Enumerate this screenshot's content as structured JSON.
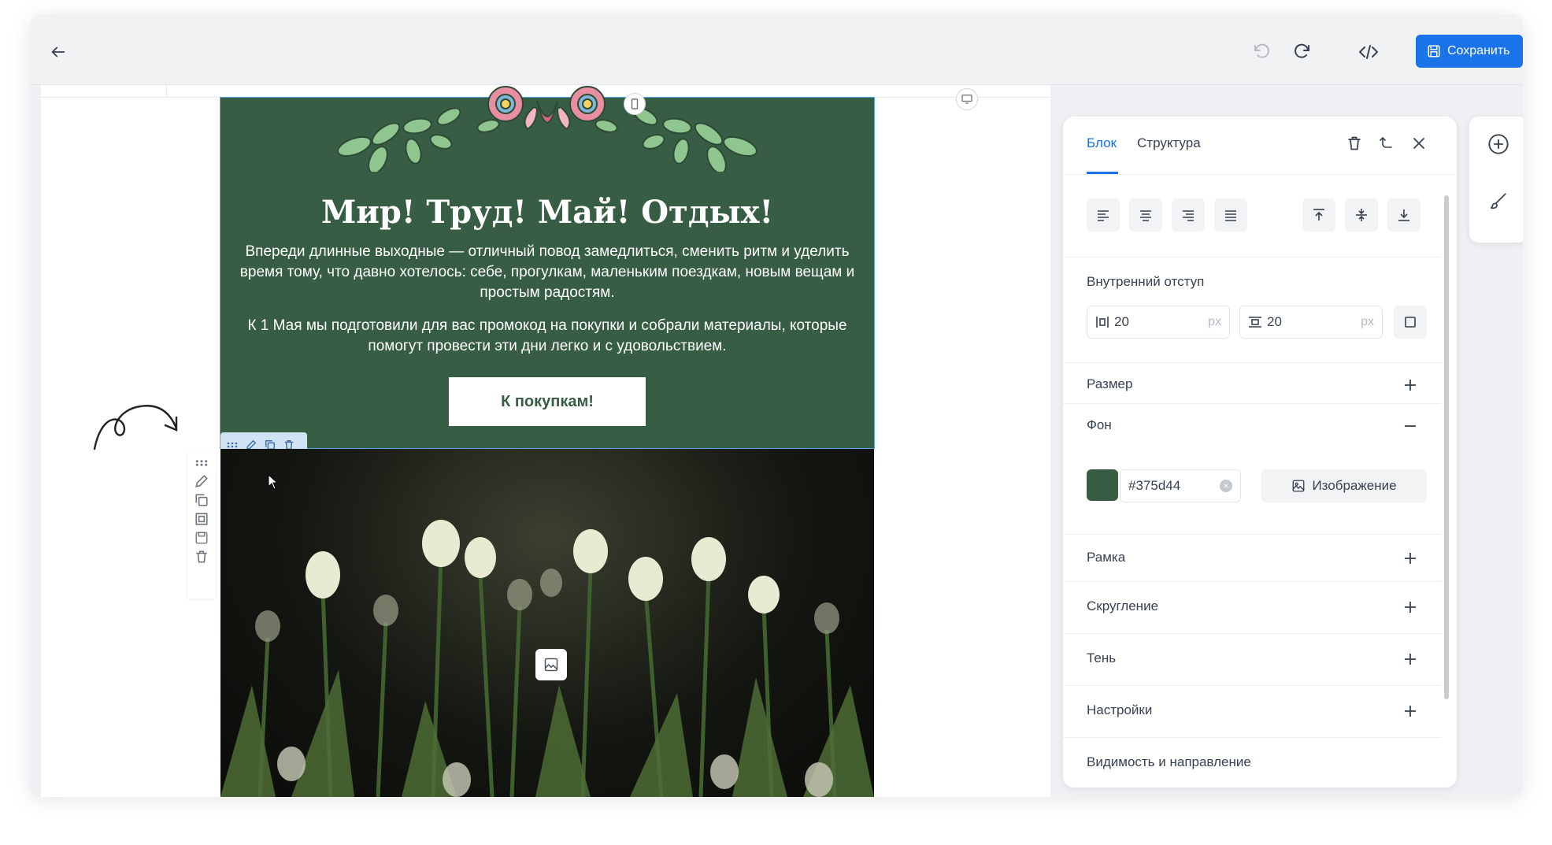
{
  "toolbar": {
    "save_label": "Сохранить",
    "back_icon": "arrow-left-icon",
    "undo_icon": "undo-icon",
    "redo_icon": "redo-icon",
    "code_icon": "code-icon"
  },
  "email": {
    "headline": "Мир! Труд! Май! Отдых!",
    "paragraph_1": "Впереди длинные выходные — отличный повод замедлиться, сменить ритм и уделить время тому, что давно хотелось: себе, прогулкам, маленьким поездкам, новым вещам и простым радостям.",
    "paragraph_2": "К 1 Мая мы подготовили для вас промокод на покупки и собрали материалы, которые помогут провести эти дни легко и с удовольствием.",
    "cta_label": "К покупкам!",
    "background_color": "#375d44"
  },
  "panel": {
    "tabs": [
      {
        "label": "Блок",
        "active": true
      },
      {
        "label": "Структура",
        "active": false
      }
    ],
    "padding": {
      "label": "Внутренний отступ",
      "horizontal_value": "20",
      "vertical_value": "20",
      "unit": "px"
    },
    "sections": {
      "size": "Размер",
      "background": "Фон",
      "border": "Рамка",
      "radius": "Скругление",
      "shadow": "Тень",
      "settings": "Настройки",
      "visibility": "Видимость и направление"
    },
    "background": {
      "color_value": "#375d44",
      "image_button": "Изображение"
    }
  },
  "colors": {
    "accent": "#1a73e8",
    "block_green": "#375d44"
  }
}
